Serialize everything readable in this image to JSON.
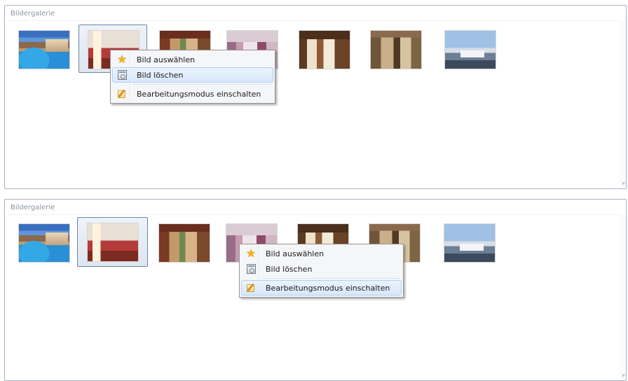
{
  "galleries": [
    {
      "title": "Bildergalerie",
      "selected_index": 1,
      "thumbnails": [
        {
          "icon": "photo-pool"
        },
        {
          "icon": "photo-room"
        },
        {
          "icon": "photo-bar"
        },
        {
          "icon": "photo-corridor"
        },
        {
          "icon": "photo-dining"
        },
        {
          "icon": "photo-lobby"
        },
        {
          "icon": "photo-view"
        }
      ],
      "context_menu": {
        "highlighted_index": 1,
        "items": [
          {
            "label": "Bild auswählen",
            "icon": "star-icon"
          },
          {
            "label": "Bild löschen",
            "icon": "delete-image-icon"
          },
          {
            "label": "Bearbeitungsmodus einschalten",
            "icon": "edit-icon"
          }
        ]
      }
    },
    {
      "title": "Bildergalerie",
      "selected_index": 1,
      "thumbnails": [
        {
          "icon": "photo-pool"
        },
        {
          "icon": "photo-room"
        },
        {
          "icon": "photo-bar"
        },
        {
          "icon": "photo-corridor"
        },
        {
          "icon": "photo-dining"
        },
        {
          "icon": "photo-lobby"
        },
        {
          "icon": "photo-view"
        }
      ],
      "context_menu": {
        "highlighted_index": 2,
        "items": [
          {
            "label": "Bild auswählen",
            "icon": "star-icon"
          },
          {
            "label": "Bild löschen",
            "icon": "delete-image-icon"
          },
          {
            "label": "Bearbeitungsmodus einschalten",
            "icon": "edit-icon"
          }
        ]
      }
    }
  ]
}
